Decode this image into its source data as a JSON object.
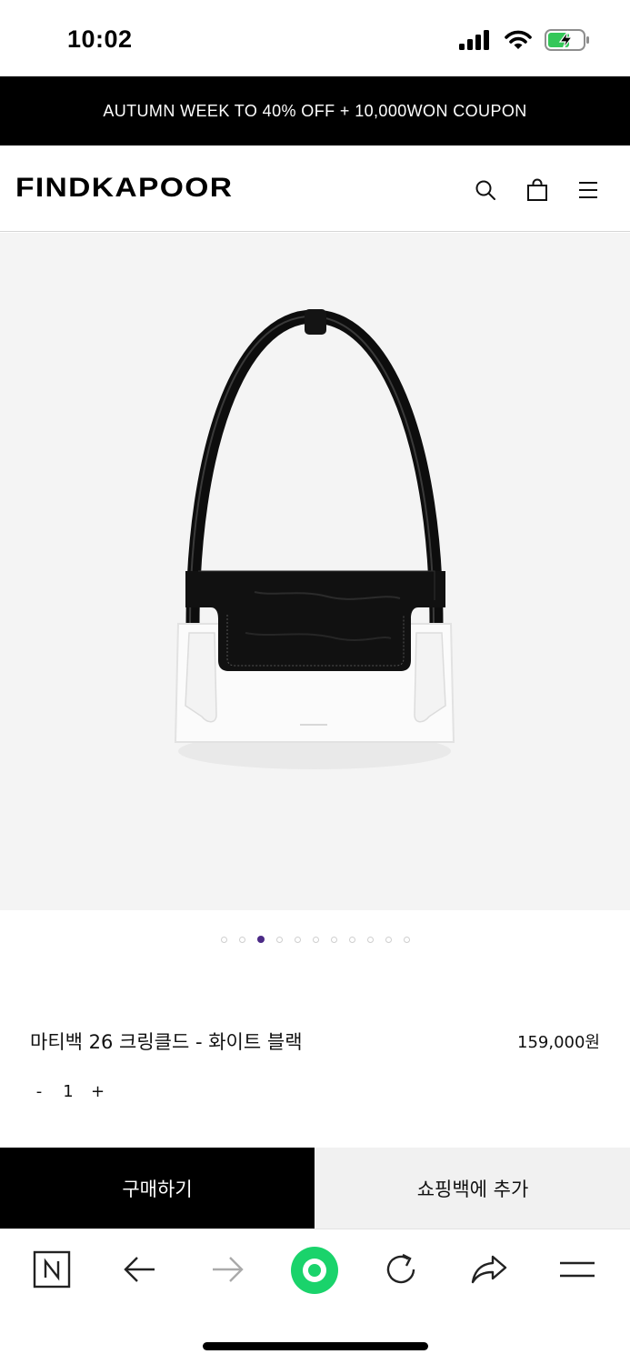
{
  "status_bar": {
    "time": "10:02",
    "icons": [
      "signal-icon",
      "wifi-icon",
      "battery-charging-icon"
    ]
  },
  "promo": {
    "text": "AUTUMN WEEK TO 40% OFF + 10,000WON COUPON"
  },
  "header": {
    "logo": "FINDKAPOOR",
    "icons": [
      "search-icon",
      "shopping-bag-icon",
      "menu-icon"
    ]
  },
  "gallery": {
    "total_images": 11,
    "active_index": 2
  },
  "product": {
    "name": "마티백 26 크링클드 - 화이트 블랙",
    "price": "159,000원",
    "quantity": {
      "minus": "-",
      "value": "1",
      "plus": "+"
    }
  },
  "actions": {
    "buy": "구매하기",
    "add_to_bag": "쇼핑백에 추가"
  },
  "browser_toolbar": {
    "icons": [
      "naver-n-icon",
      "back-arrow-icon",
      "forward-arrow-icon",
      "green-dot-home-icon",
      "reload-icon",
      "share-icon",
      "hamburger-menu-icon"
    ],
    "accent_color": "#1ad36b"
  }
}
